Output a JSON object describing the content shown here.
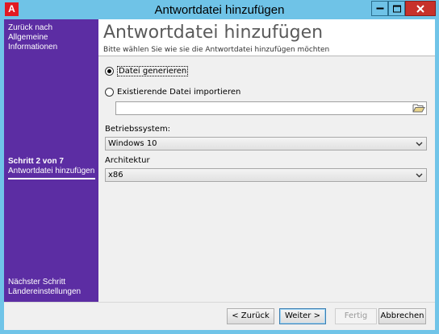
{
  "window": {
    "title": "Antwortdatei hinzufügen",
    "app_icon_letter": "A",
    "close_icon": "close-icon",
    "titlebar_color": "#6fc3e7",
    "close_color": "#c7312a"
  },
  "sidebar": {
    "background": "#5c2da3",
    "previous": {
      "line1": "Zurück nach",
      "line2": "Allgemeine Informationen"
    },
    "current": {
      "step": "Schritt 2 von 7",
      "name": "Antwortdatei hinzufügen"
    },
    "next": {
      "line1": "Nächster Schritt",
      "line2": "Ländereinstellungen"
    }
  },
  "header": {
    "title": "Antwortdatei hinzufügen",
    "subtitle": "Bitte wählen Sie wie sie die Antwortdatei hinzufügen möchten"
  },
  "options": {
    "generate_label": "Datei generieren",
    "generate_selected": true,
    "import_label": "Existierende Datei importieren",
    "import_selected": false,
    "import_path_value": "",
    "browse_icon": "folder-open-icon"
  },
  "os": {
    "label": "Betriebssystem:",
    "value": "Windows 10"
  },
  "arch": {
    "label": "Architektur",
    "value": "x86"
  },
  "footer": {
    "back_label": "< Zurück",
    "next_label": "Weiter >",
    "finish_label": "Fertig",
    "cancel_label": "Abbrechen"
  }
}
